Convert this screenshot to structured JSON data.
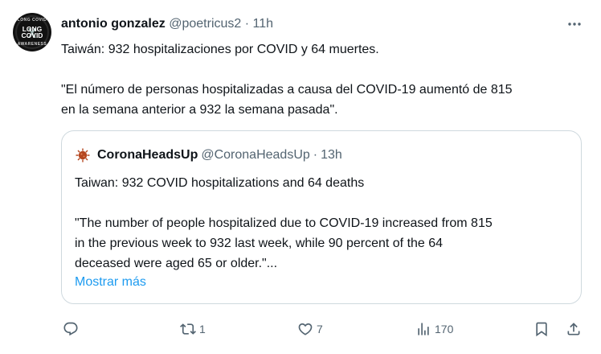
{
  "tweet": {
    "author_name": "antonio gonzalez",
    "author_handle": "@poetricus2",
    "separator": "·",
    "time": "11h",
    "text_line1": "Taiwán: 932 hospitalizaciones por COVID y 64 muertes.",
    "text_line2": "\"El número de personas hospitalizadas a causa del COVID-19 aumentó de 815",
    "text_line3": "en la semana anterior a 932 la semana pasada\".",
    "avatar_text": "LONG COVID",
    "avatar_top": "LONG COVID",
    "avatar_bottom": "AWARENESS"
  },
  "quote": {
    "author_name": "CoronaHeadsUp",
    "author_handle": "@CoronaHeadsUp",
    "separator": "·",
    "time": "13h",
    "text_line1": "Taiwan: 932 COVID hospitalizations and 64 deaths",
    "text_line2": "\"The number of people hospitalized due to COVID-19 increased from 815",
    "text_line3": "in the previous week to 932 last week, while 90 percent of the 64",
    "text_line4": "deceased  were aged 65 or older.\"...",
    "show_more": "Mostrar más"
  },
  "actions": {
    "reply_count": "",
    "retweet_count": "1",
    "like_count": "7",
    "views_count": "170"
  },
  "icons": {
    "more": "more-horizontal-icon",
    "reply": "reply-icon",
    "retweet": "retweet-icon",
    "like": "heart-icon",
    "views": "analytics-icon",
    "bookmark": "bookmark-icon",
    "share": "share-icon",
    "quote_avatar": "virus-icon"
  },
  "colors": {
    "text": "#0f1419",
    "muted": "#536471",
    "link": "#1d9bf0",
    "border": "#cfd9de",
    "virus": "#b5461f"
  }
}
